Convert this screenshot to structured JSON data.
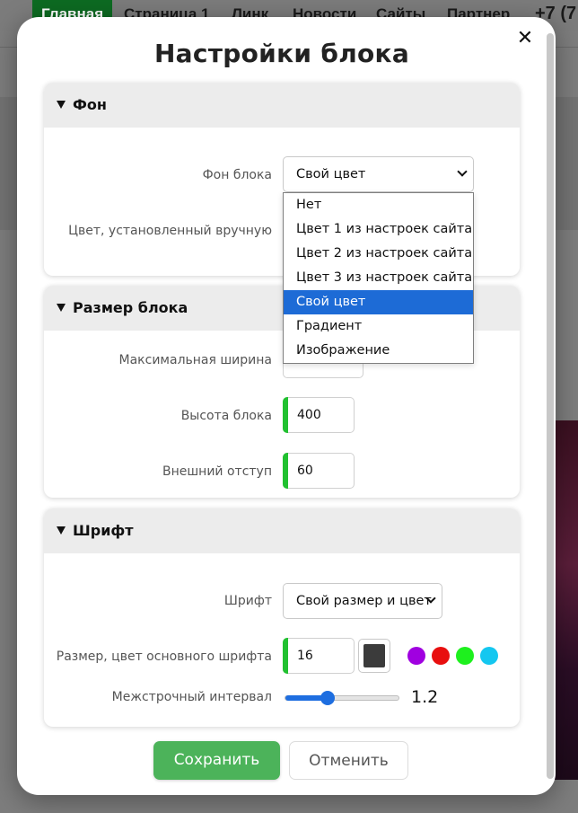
{
  "background": {
    "nav": [
      "Главная",
      "Страница 1",
      "Линк",
      "Новости",
      "Сайты",
      "Партнер"
    ],
    "phone": "+7 (7"
  },
  "modal": {
    "title": "Настройки блока",
    "close_icon": "close-icon"
  },
  "sections": {
    "fon": {
      "title": "Фон",
      "bg_label": "Фон блока",
      "bg_value": "Свой цвет",
      "manual_color_label": "Цвет, установленный вручную"
    },
    "size": {
      "title": "Размер блока",
      "max_width_label": "Максимальная ширина",
      "height_label": "Высота блока",
      "height_value": "400",
      "margin_label": "Внешний отступ",
      "margin_value": "60"
    },
    "font": {
      "title": "Шрифт",
      "font_label": "Шрифт",
      "font_value": "Свой размер и цвет",
      "size_color_label": "Размер, цвет основного шрифта",
      "size_value": "16",
      "swatch_color": "#3b3b3b",
      "palette": [
        "#a000e0",
        "#e80f0f",
        "#1ef01e",
        "#14c7f0"
      ],
      "line_height_label": "Межстрочный интервал",
      "line_height_value": "1.2",
      "line_height_fraction": 0.35
    }
  },
  "dropdown": {
    "options": [
      "Нет",
      "Цвет 1 из настроек сайта",
      "Цвет 2 из настроек сайта",
      "Цвет 3 из настроек сайта",
      "Свой цвет",
      "Градиент",
      "Изображение"
    ],
    "selected_index": 4
  },
  "buttons": {
    "save": "Сохранить",
    "cancel": "Отменить"
  }
}
